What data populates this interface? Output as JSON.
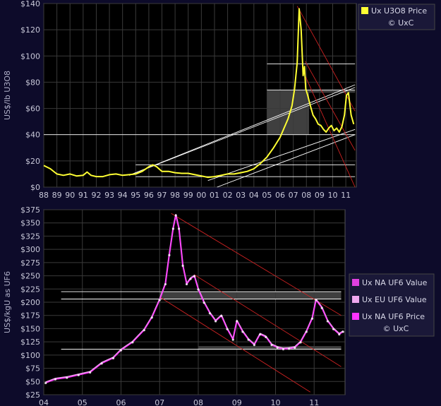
{
  "chart_data": [
    {
      "type": "line",
      "ylabel": "US$/lb U3O8",
      "xlim": [
        1988,
        2011.8
      ],
      "ylim": [
        0,
        140
      ],
      "yticks": [
        0,
        20,
        40,
        60,
        80,
        100,
        120,
        140
      ],
      "ytick_labels": [
        "$0",
        "$20",
        "$40",
        "$60",
        "$80",
        "$100",
        "$120",
        "$140"
      ],
      "xtick_values": [
        1988,
        1989,
        1990,
        1991,
        1992,
        1993,
        1994,
        1995,
        1996,
        1997,
        1998,
        1999,
        2000,
        2001,
        2002,
        2003,
        2004,
        2005,
        2006,
        2007,
        2008,
        2009,
        2010,
        2011
      ],
      "xtick_labels": [
        "88",
        "89",
        "90",
        "91",
        "92",
        "93",
        "94",
        "95",
        "96",
        "97",
        "98",
        "99",
        "00",
        "01",
        "02",
        "03",
        "04",
        "05",
        "06",
        "07",
        "08",
        "09",
        "10",
        "11"
      ],
      "grid": true,
      "legend_position": "top-right",
      "legend": [
        "Ux U3O8 Price",
        "© UxC"
      ],
      "colors": {
        "series": "#ffff33",
        "background": "#000000",
        "grid": "#3a3a3a",
        "lines": "#ffffff",
        "channel": "#cc2222",
        "band": "#4a4a4a"
      },
      "series": [
        {
          "name": "Ux U3O8 Price",
          "x": [
            1988.0,
            1988.5,
            1989.0,
            1989.5,
            1990.0,
            1990.5,
            1991.0,
            1991.3,
            1991.6,
            1992.0,
            1992.5,
            1993.0,
            1993.5,
            1994.0,
            1994.5,
            1995.0,
            1995.5,
            1996.0,
            1996.3,
            1996.6,
            1997.0,
            1997.5,
            1998.0,
            1998.5,
            1999.0,
            1999.5,
            2000.0,
            2000.5,
            2001.0,
            2001.5,
            2002.0,
            2002.5,
            2003.0,
            2003.5,
            2004.0,
            2004.5,
            2005.0,
            2005.5,
            2006.0,
            2006.3,
            2006.6,
            2006.9,
            2007.1,
            2007.3,
            2007.45,
            2007.6,
            2007.75,
            2007.85,
            2007.95,
            2008.1,
            2008.3,
            2008.5,
            2008.7,
            2008.9,
            2009.1,
            2009.3,
            2009.5,
            2009.7,
            2009.9,
            2010.1,
            2010.3,
            2010.5,
            2010.7,
            2010.9,
            2011.05,
            2011.2,
            2011.4,
            2011.6
          ],
          "values": [
            16.5,
            14,
            10,
            9,
            10,
            8.5,
            9,
            11.5,
            9,
            8,
            8,
            9.5,
            10,
            9,
            9.5,
            10,
            12,
            15.5,
            17,
            15.5,
            12,
            12,
            11,
            10.5,
            10.5,
            9.5,
            8.5,
            7.5,
            8,
            9,
            10,
            10,
            11,
            12,
            14,
            18,
            23,
            30,
            38,
            45,
            52,
            62,
            75,
            95,
            136,
            120,
            85,
            92,
            75,
            70,
            62,
            55,
            52,
            48,
            47,
            44,
            42,
            45,
            47,
            43,
            45,
            42,
            46,
            55,
            70,
            72,
            55,
            48
          ]
        }
      ],
      "annotations": [
        {
          "kind": "hline",
          "y": 94,
          "x": [
            2005.0,
            2011.7
          ]
        },
        {
          "kind": "hline",
          "y": 74,
          "x": [
            2005.0,
            2011.7
          ]
        },
        {
          "kind": "hline",
          "y": 40,
          "x": [
            1988.0,
            2011.7
          ]
        },
        {
          "kind": "hline",
          "y": 17,
          "x": [
            1995.0,
            2011.7
          ]
        },
        {
          "kind": "hline",
          "y": 8,
          "x": [
            1995.0,
            2011.7
          ]
        },
        {
          "kind": "band",
          "x": [
            2005.0,
            2008.2
          ],
          "y": [
            40,
            74
          ]
        },
        {
          "kind": "band",
          "x": [
            2008.2,
            2011.7
          ],
          "y": [
            72,
            74
          ]
        },
        {
          "kind": "trend",
          "color": "white",
          "x": [
            1994.5,
            2011.7
          ],
          "y": [
            9,
            78
          ]
        },
        {
          "kind": "trend",
          "color": "white",
          "x": [
            1994.5,
            2011.7
          ],
          "y": [
            9,
            76
          ]
        },
        {
          "kind": "trend",
          "color": "white",
          "x": [
            2000.5,
            2011.7
          ],
          "y": [
            5,
            44
          ]
        },
        {
          "kind": "trend",
          "color": "white",
          "x": [
            2001.2,
            2011.7
          ],
          "y": [
            0,
            40
          ]
        },
        {
          "kind": "trend",
          "color": "red",
          "x": [
            2007.3,
            2011.7
          ],
          "y": [
            138,
            58
          ]
        },
        {
          "kind": "trend",
          "color": "red",
          "x": [
            2007.9,
            2011.7
          ],
          "y": [
            96,
            28
          ]
        },
        {
          "kind": "trend",
          "color": "red",
          "x": [
            2007.9,
            2011.7
          ],
          "y": [
            85,
            0
          ]
        }
      ]
    },
    {
      "type": "line",
      "ylabel": "US$/kgU as UF6",
      "xlim": [
        2004.0,
        2011.8
      ],
      "ylim": [
        25,
        375
      ],
      "yticks": [
        25,
        50,
        75,
        100,
        125,
        150,
        175,
        200,
        225,
        250,
        275,
        300,
        325,
        350,
        375
      ],
      "ytick_labels": [
        "$25",
        "$50",
        "$75",
        "$100",
        "$125",
        "$150",
        "$175",
        "$200",
        "$225",
        "$250",
        "$275",
        "$300",
        "$325",
        "$350",
        "$375"
      ],
      "xtick_values": [
        2004,
        2005,
        2006,
        2007,
        2008,
        2009,
        2010,
        2011
      ],
      "xtick_labels": [
        "04",
        "05",
        "06",
        "07",
        "08",
        "09",
        "10",
        "11"
      ],
      "grid": true,
      "legend_position": "right",
      "legend": [
        "Ux NA UF6 Value",
        "Ux EU UF6 Value",
        "Ux NA UF6 Price",
        "© UxC"
      ],
      "colors": {
        "na_value": "#e040e0",
        "eu_value": "#f0a8f0",
        "na_price": "#ff33ff",
        "background": "#000000",
        "grid": "#3a3a3a",
        "lines": "#ffffff",
        "channel": "#cc2222",
        "band": "#4a4a4a"
      },
      "series": [
        {
          "name": "Ux NA UF6 Value",
          "x": [
            2004.05,
            2004.3,
            2004.6,
            2004.9,
            2005.2,
            2005.5,
            2005.8,
            2006.0,
            2006.3,
            2006.6,
            2006.8,
            2007.0,
            2007.15,
            2007.25,
            2007.35,
            2007.42,
            2007.5,
            2007.6,
            2007.7,
            2007.8,
            2007.9,
            2008.0,
            2008.15,
            2008.3,
            2008.45,
            2008.6,
            2008.75,
            2008.9,
            2009.0,
            2009.15,
            2009.3,
            2009.45,
            2009.6,
            2009.75,
            2009.9,
            2010.05,
            2010.2,
            2010.35,
            2010.5,
            2010.65,
            2010.8,
            2010.95,
            2011.05,
            2011.2,
            2011.35,
            2011.5,
            2011.65,
            2011.75
          ],
          "values": [
            48,
            55,
            58,
            63,
            68,
            85,
            95,
            110,
            125,
            148,
            172,
            205,
            235,
            290,
            340,
            365,
            340,
            270,
            235,
            245,
            250,
            225,
            200,
            180,
            165,
            175,
            150,
            130,
            165,
            145,
            130,
            120,
            140,
            135,
            120,
            115,
            112,
            113,
            115,
            125,
            145,
            170,
            205,
            190,
            165,
            150,
            140,
            145
          ]
        },
        {
          "name": "Ux EU UF6 Value",
          "x": [
            2004.05,
            2004.3,
            2004.6,
            2004.9,
            2005.2,
            2005.5,
            2005.8,
            2006.0,
            2006.3,
            2006.6,
            2006.8,
            2007.0,
            2007.15,
            2007.25,
            2007.35,
            2007.42,
            2007.5,
            2007.6,
            2007.7,
            2007.8,
            2007.9,
            2008.0,
            2008.15,
            2008.3,
            2008.45,
            2008.6,
            2008.75,
            2008.9,
            2009.0,
            2009.15,
            2009.3,
            2009.45,
            2009.6,
            2009.75,
            2009.9,
            2010.05,
            2010.2,
            2010.35,
            2010.5,
            2010.65,
            2010.8,
            2010.95,
            2011.05,
            2011.2,
            2011.35,
            2011.5,
            2011.65,
            2011.75
          ],
          "values": [
            49,
            56,
            59,
            64,
            69,
            86,
            96,
            111,
            126,
            149,
            173,
            206,
            236,
            291,
            341,
            366,
            341,
            271,
            236,
            246,
            251,
            226,
            201,
            181,
            166,
            176,
            151,
            131,
            166,
            146,
            131,
            121,
            141,
            136,
            121,
            116,
            113,
            114,
            116,
            126,
            146,
            171,
            206,
            191,
            166,
            151,
            141,
            146
          ]
        },
        {
          "name": "Ux NA UF6 Price",
          "x": [
            2004.05,
            2004.3,
            2004.6,
            2004.9,
            2005.2,
            2005.5,
            2005.8,
            2006.0,
            2006.3,
            2006.6,
            2006.8,
            2007.0,
            2007.15,
            2007.25,
            2007.35,
            2007.42,
            2007.5,
            2007.6,
            2007.7,
            2007.8,
            2007.9,
            2008.0,
            2008.15,
            2008.3,
            2008.45,
            2008.6,
            2008.75,
            2008.9,
            2009.0,
            2009.15,
            2009.3,
            2009.45,
            2009.6,
            2009.75,
            2009.9,
            2010.05,
            2010.2,
            2010.35,
            2010.5,
            2010.65,
            2010.8,
            2010.95,
            2011.05,
            2011.2,
            2011.35,
            2011.5,
            2011.65,
            2011.75
          ],
          "values": [
            47,
            54,
            57,
            62,
            67,
            84,
            94,
            109,
            124,
            147,
            171,
            204,
            234,
            289,
            339,
            364,
            339,
            269,
            234,
            244,
            249,
            224,
            199,
            179,
            164,
            174,
            149,
            129,
            164,
            144,
            129,
            119,
            139,
            134,
            119,
            114,
            111,
            112,
            114,
            124,
            144,
            169,
            204,
            189,
            164,
            149,
            139,
            144
          ]
        }
      ],
      "annotations": [
        {
          "kind": "hline",
          "y": 220,
          "x": [
            2004.45,
            2011.7
          ]
        },
        {
          "kind": "hline",
          "y": 206,
          "x": [
            2004.45,
            2011.7
          ]
        },
        {
          "kind": "hline",
          "y": 111,
          "x": [
            2004.45,
            2011.7
          ]
        },
        {
          "kind": "band",
          "x": [
            2007.0,
            2011.7
          ],
          "y": [
            206,
            220
          ]
        },
        {
          "kind": "band",
          "x": [
            2008.0,
            2011.7
          ],
          "y": [
            111,
            117
          ]
        },
        {
          "kind": "trend",
          "color": "red",
          "x": [
            2007.3,
            2011.7
          ],
          "y": [
            368,
            175
          ]
        },
        {
          "kind": "trend",
          "color": "red",
          "x": [
            2007.9,
            2011.7
          ],
          "y": [
            252,
            78
          ]
        },
        {
          "kind": "trend",
          "color": "red",
          "x": [
            2007.0,
            2010.9
          ],
          "y": [
            210,
            30
          ]
        }
      ]
    }
  ]
}
